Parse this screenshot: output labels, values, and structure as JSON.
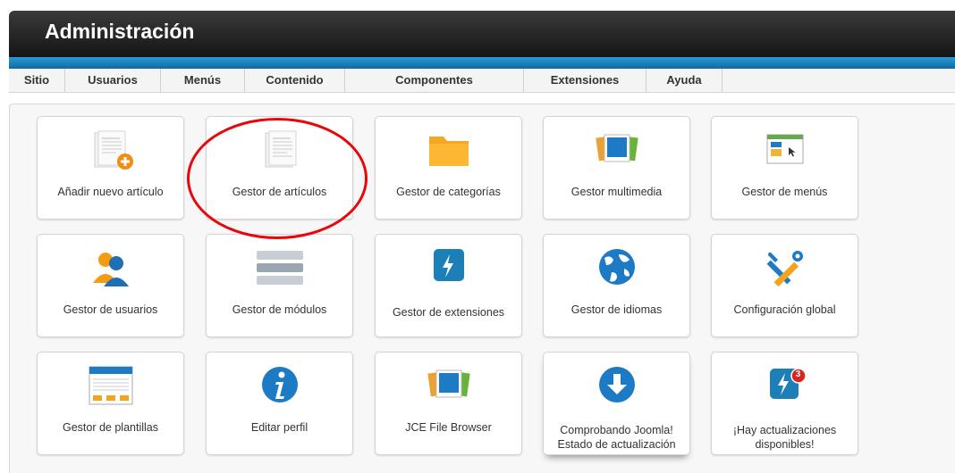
{
  "header": {
    "title": "Administración"
  },
  "menu": [
    {
      "label": "Sitio"
    },
    {
      "label": "Usuarios"
    },
    {
      "label": "Menús"
    },
    {
      "label": "Contenido"
    },
    {
      "label": "Componentes"
    },
    {
      "label": "Extensiones"
    },
    {
      "label": "Ayuda"
    }
  ],
  "tiles": [
    {
      "label": "Añadir nuevo artículo",
      "icon": "add-article-icon"
    },
    {
      "label": "Gestor de artículos",
      "icon": "article-icon"
    },
    {
      "label": "Gestor de categorías",
      "icon": "folder-icon"
    },
    {
      "label": "Gestor multimedia",
      "icon": "media-icon"
    },
    {
      "label": "Gestor de menús",
      "icon": "menu-window-icon"
    },
    {
      "label": "Gestor de usuarios",
      "icon": "users-icon"
    },
    {
      "label": "Gestor de módulos",
      "icon": "modules-icon"
    },
    {
      "label": "Gestor de extensiones",
      "icon": "extensions-icon"
    },
    {
      "label": "Gestor de idiomas",
      "icon": "globe-icon"
    },
    {
      "label": "Configuración global",
      "icon": "tools-icon"
    },
    {
      "label": "Gestor de plantillas",
      "icon": "template-icon"
    },
    {
      "label": "Editar perfil",
      "icon": "info-icon"
    },
    {
      "label": "JCE File Browser",
      "icon": "media-icon"
    },
    {
      "label": "Comprobando Joomla! Estado de actualización",
      "icon": "download-icon"
    },
    {
      "label": "¡Hay actualizaciones disponibles!",
      "icon": "update-badge-icon",
      "badge": "3"
    }
  ],
  "colors": {
    "accent": "#1a7fc0",
    "highlight_circle": "#e8070b",
    "header_bg": "#222222"
  }
}
